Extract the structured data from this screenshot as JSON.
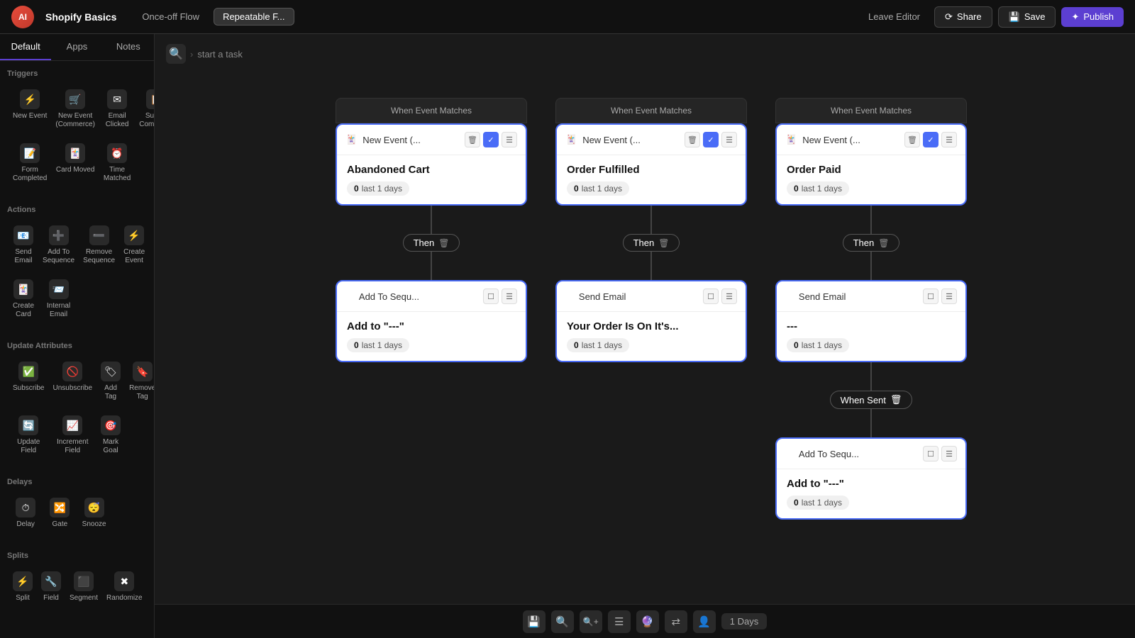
{
  "header": {
    "logo_text": "AI",
    "app_title": "Shopify Basics",
    "tabs": [
      {
        "label": "Once-off Flow",
        "active": false
      },
      {
        "label": "Repeatable F...",
        "active": true
      }
    ],
    "leave_editor": "Leave Editor",
    "share": "Share",
    "save": "Save",
    "publish": "Publish"
  },
  "sidebar": {
    "tabs": [
      "Default",
      "Apps",
      "Notes"
    ],
    "active_tab": "Default",
    "sections": [
      {
        "title": "Triggers",
        "items": [
          {
            "label": "New Event",
            "icon": "⚡"
          },
          {
            "label": "New Event (Commerce)",
            "icon": "🛒"
          },
          {
            "label": "Email Clicked",
            "icon": "✉"
          },
          {
            "label": "Survey Completed",
            "icon": "📋"
          },
          {
            "label": "Form Completed",
            "icon": "📝"
          },
          {
            "label": "Card Moved",
            "icon": "🃏"
          },
          {
            "label": "Time Matched",
            "icon": "⏰"
          }
        ]
      },
      {
        "title": "Actions",
        "items": [
          {
            "label": "Send Email",
            "icon": "📧"
          },
          {
            "label": "Add To Sequence",
            "icon": "➕"
          },
          {
            "label": "Remove Sequence",
            "icon": "➖"
          },
          {
            "label": "Create Event",
            "icon": "⚡"
          },
          {
            "label": "Create Card",
            "icon": "🃏"
          },
          {
            "label": "Internal Email",
            "icon": "📨"
          }
        ]
      },
      {
        "title": "Update Attributes",
        "items": [
          {
            "label": "Subscribe",
            "icon": "✅"
          },
          {
            "label": "Unsubscribe",
            "icon": "🚫"
          },
          {
            "label": "Add Tag",
            "icon": "🏷"
          },
          {
            "label": "Remove Tag",
            "icon": "🔖"
          },
          {
            "label": "Update Field",
            "icon": "🔄"
          },
          {
            "label": "Increment Field",
            "icon": "📈"
          },
          {
            "label": "Mark Goal",
            "icon": "🎯"
          }
        ]
      },
      {
        "title": "Delays",
        "items": [
          {
            "label": "Delay",
            "icon": "⏱"
          },
          {
            "label": "Gate",
            "icon": "🔀"
          },
          {
            "label": "Snooze",
            "icon": "😴"
          }
        ]
      },
      {
        "title": "Splits",
        "items": [
          {
            "label": "Split",
            "icon": "⚡"
          },
          {
            "label": "Field",
            "icon": "🔧"
          },
          {
            "label": "Segment",
            "icon": "⬛"
          },
          {
            "label": "Randomize",
            "icon": "✖"
          }
        ]
      }
    ]
  },
  "breadcrumb": {
    "search_icon": "🔍",
    "path": "start a task"
  },
  "flow": {
    "columns": [
      {
        "event_header": "When Event Matches",
        "trigger": {
          "type_icon": "🃏",
          "title": "New Event (...",
          "event_name": "Abandoned Cart",
          "stat": "0 last 1 days"
        },
        "then_label": "Then",
        "action": {
          "type_icon": "➡",
          "title": "Add To Sequ...",
          "event_name": "Add to \"---\"",
          "stat": "0 last 1 days"
        }
      },
      {
        "event_header": "When Event Matches",
        "trigger": {
          "type_icon": "🃏",
          "title": "New Event (...",
          "event_name": "Order Fulfilled",
          "stat": "0 last 1 days"
        },
        "then_label": "Then",
        "action": {
          "type_icon": "✈",
          "title": "Send Email",
          "event_name": "Your Order Is On It's...",
          "stat": "0 last 1 days"
        }
      },
      {
        "event_header": "When Event Matches",
        "trigger": {
          "type_icon": "🃏",
          "title": "New Event (...",
          "event_name": "Order Paid",
          "stat": "0 last 1 days"
        },
        "then_label": "Then",
        "action": {
          "type_icon": "✈",
          "title": "Send Email",
          "event_name": "---",
          "stat": "0 last 1 days"
        },
        "when_sent_label": "When Sent",
        "sub_action": {
          "type_icon": "➡",
          "title": "Add To Sequ...",
          "event_name": "Add to \"---\"",
          "stat": "0 last 1 days"
        }
      }
    ]
  },
  "toolbar": {
    "buttons": [
      "💾",
      "🔍−",
      "🔍+",
      "☰",
      "🔮",
      "⇄",
      "👤"
    ],
    "days_label": "1 Days"
  }
}
